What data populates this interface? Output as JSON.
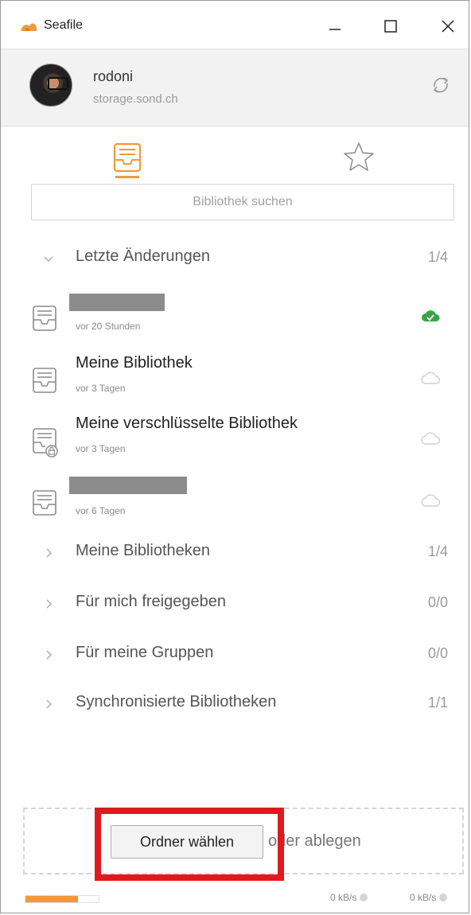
{
  "window": {
    "title": "Seafile"
  },
  "account": {
    "name": "rodoni",
    "server": "storage.sond.ch"
  },
  "search": {
    "placeholder": "Bibliothek suchen"
  },
  "sections": {
    "recent": {
      "label": "Letzte Änderungen",
      "count": "1/4"
    },
    "my_libs": {
      "label": "Meine Bibliotheken",
      "count": "1/4"
    },
    "shared_with_me": {
      "label": "Für mich freigegeben",
      "count": "0/0"
    },
    "group_libs": {
      "label": "Für meine Gruppen",
      "count": "0/0"
    },
    "synced_libs": {
      "label": "Synchronisierte Bibliotheken",
      "count": "1/1"
    }
  },
  "recent_items": [
    {
      "name": "",
      "time": "vor 20 Stunden",
      "status": "synced",
      "redacted": true
    },
    {
      "name": "Meine Bibliothek",
      "time": "vor 3 Tagen",
      "status": "cloud",
      "redacted": false
    },
    {
      "name": "Meine verschlüsselte Bibliothek",
      "time": "vor 3 Tagen",
      "status": "cloud",
      "redacted": false,
      "encrypted": true
    },
    {
      "name": "",
      "time": "vor 6 Tagen",
      "status": "cloud",
      "redacted": true
    }
  ],
  "dropzone": {
    "button_label": "Ordner wählen",
    "text": "oder ablegen"
  },
  "statusbar": {
    "upload_progress": 0.72,
    "download_rate": "0 kB/s",
    "upload_rate": "0 kB/s"
  },
  "colors": {
    "accent": "#f09a3a",
    "synced": "#3aa34a",
    "highlight": "#e0191f"
  }
}
